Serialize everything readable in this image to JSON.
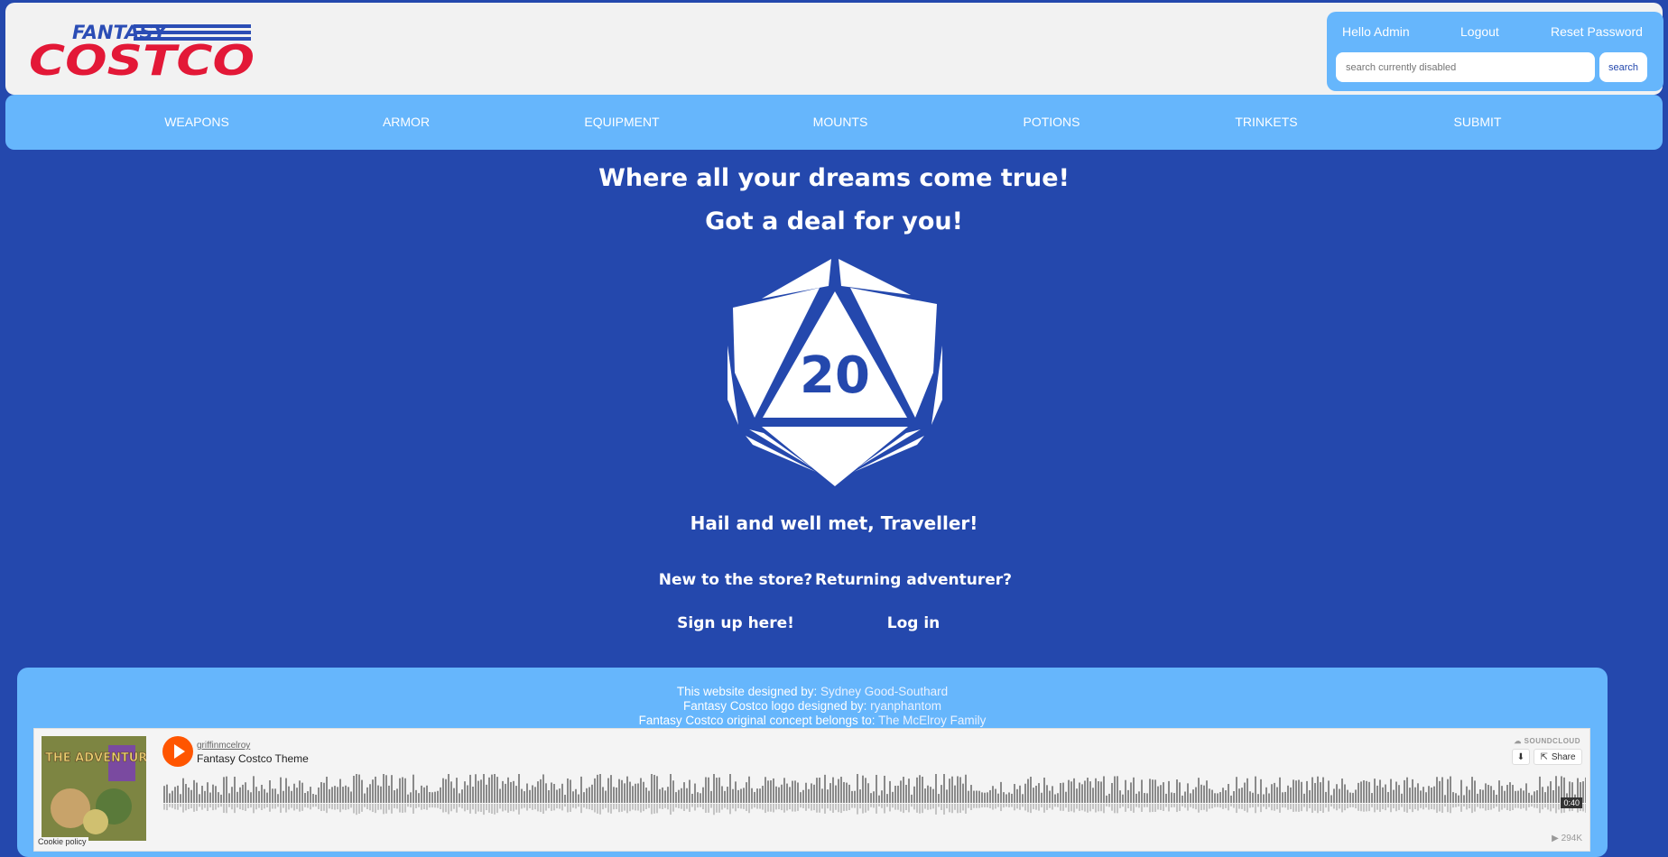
{
  "header": {
    "logo_alt": "Fantasy Costco",
    "logo_top_text": "FANTASY",
    "logo_main_text": "COSTCO",
    "greeting": "Hello Admin",
    "logout_label": "Logout",
    "reset_label": "Reset Password",
    "search_placeholder": "search currently disabled",
    "search_button": "search"
  },
  "nav": {
    "items": [
      "WEAPONS",
      "ARMOR",
      "EQUIPMENT",
      "MOUNTS",
      "POTIONS",
      "TRINKETS",
      "SUBMIT"
    ]
  },
  "main": {
    "headline": "Where all your dreams come true!",
    "subheadline": "Got a deal for you!",
    "die_number": "20",
    "greeting": "Hail and well met, Traveller!",
    "new_prompt": "New to the store?",
    "returning_prompt": "Returning adventurer?",
    "signup_link": "Sign up here!",
    "login_link": "Log in"
  },
  "footer": {
    "designer_prefix": "This website designed by:",
    "designer_name": "Sydney Good-Southard",
    "logo_prefix": "Fantasy Costco logo designed by:",
    "logo_designer": "ryanphantom",
    "concept_prefix": "Fantasy Costco original concept belongs to:",
    "concept_owner": "The McElroy Family"
  },
  "player": {
    "uploader": "griffinmcelroy",
    "track_title": "Fantasy Costco Theme",
    "brand": "SOUNDCLOUD",
    "share_label": "Share",
    "duration": "0:40",
    "plays": "▶ 294K",
    "cookie_policy": "Cookie policy",
    "artwork_text": "THE ADVENTURE ZONE"
  },
  "colors": {
    "background": "#2448ad",
    "accent": "#66b6fc",
    "logo_red": "#e31837",
    "logo_blue": "#2b4db5",
    "soundcloud_orange": "#ff5500"
  }
}
